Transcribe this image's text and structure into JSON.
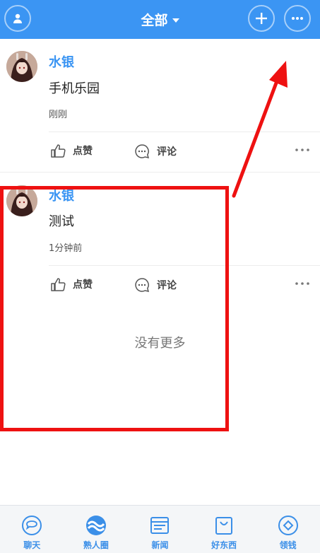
{
  "header": {
    "title": "全部"
  },
  "posts": [
    {
      "username": "水银",
      "content": "手机乐园",
      "time": "刚刚",
      "like_label": "点赞",
      "comment_label": "评论"
    },
    {
      "username": "水银",
      "content": "测试",
      "time": "1分钟前",
      "like_label": "点赞",
      "comment_label": "评论"
    }
  ],
  "feed_end": "没有更多",
  "bottom_nav": {
    "items": [
      {
        "label": "聊天",
        "icon": "chat-icon"
      },
      {
        "label": "熟人圈",
        "icon": "moments-icon"
      },
      {
        "label": "新闻",
        "icon": "news-icon"
      },
      {
        "label": "好东西",
        "icon": "shopping-bag-icon"
      },
      {
        "label": "领钱",
        "icon": "money-diamond-icon"
      }
    ]
  },
  "colors": {
    "brand_blue": "#3b95f3",
    "annotation_red": "#ee1111"
  }
}
